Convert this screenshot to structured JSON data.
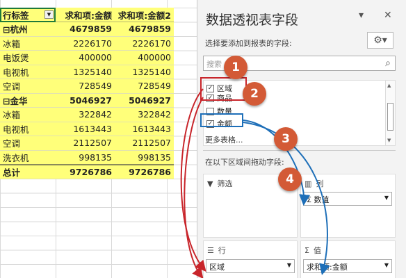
{
  "pivot": {
    "headers": [
      "行标签",
      "求和项:金额",
      "求和项:金额2"
    ],
    "groups": [
      {
        "label": "⊟杭州",
        "v1": "4679859",
        "v2": "4679859",
        "items": [
          {
            "label": "冰箱",
            "v1": "2226170",
            "v2": "2226170"
          },
          {
            "label": "电饭煲",
            "v1": "400000",
            "v2": "400000"
          },
          {
            "label": "电视机",
            "v1": "1325140",
            "v2": "1325140"
          },
          {
            "label": "空调",
            "v1": "728549",
            "v2": "728549"
          }
        ]
      },
      {
        "label": "⊟金华",
        "v1": "5046927",
        "v2": "5046927",
        "items": [
          {
            "label": "冰箱",
            "v1": "322842",
            "v2": "322842"
          },
          {
            "label": "电视机",
            "v1": "1613443",
            "v2": "1613443"
          },
          {
            "label": "空调",
            "v1": "2112507",
            "v2": "2112507"
          },
          {
            "label": "洗衣机",
            "v1": "998135",
            "v2": "998135"
          }
        ]
      }
    ],
    "total": {
      "label": "总计",
      "v1": "9726786",
      "v2": "9726786"
    }
  },
  "pane": {
    "title": "数据透视表字段",
    "subtitle": "选择要添加到报表的字段:",
    "search_placeholder": "搜索",
    "fields": [
      {
        "label": "区域",
        "checked": true
      },
      {
        "label": "商品",
        "checked": true
      },
      {
        "label": "数量",
        "checked": false
      },
      {
        "label": "金额",
        "checked": true
      }
    ],
    "more_tables": "更多表格...",
    "drag_hint": "在以下区域间拖动字段:",
    "areas": {
      "filter": {
        "title": "筛选"
      },
      "columns": {
        "title": "列",
        "items": [
          "数值"
        ]
      },
      "rows": {
        "title": "行",
        "items": [
          "区域"
        ]
      },
      "values": {
        "title": "值",
        "items": [
          "求和项:金额"
        ]
      }
    }
  },
  "annotations": {
    "badges": [
      "1",
      "2",
      "3",
      "4"
    ],
    "red_color": "#c8252b",
    "blue_color": "#1e6fb8",
    "badge_color": "#d35a36"
  },
  "colors": {
    "pivot_fill": "#ffff7a",
    "pane_bg": "#f3f3f3"
  }
}
